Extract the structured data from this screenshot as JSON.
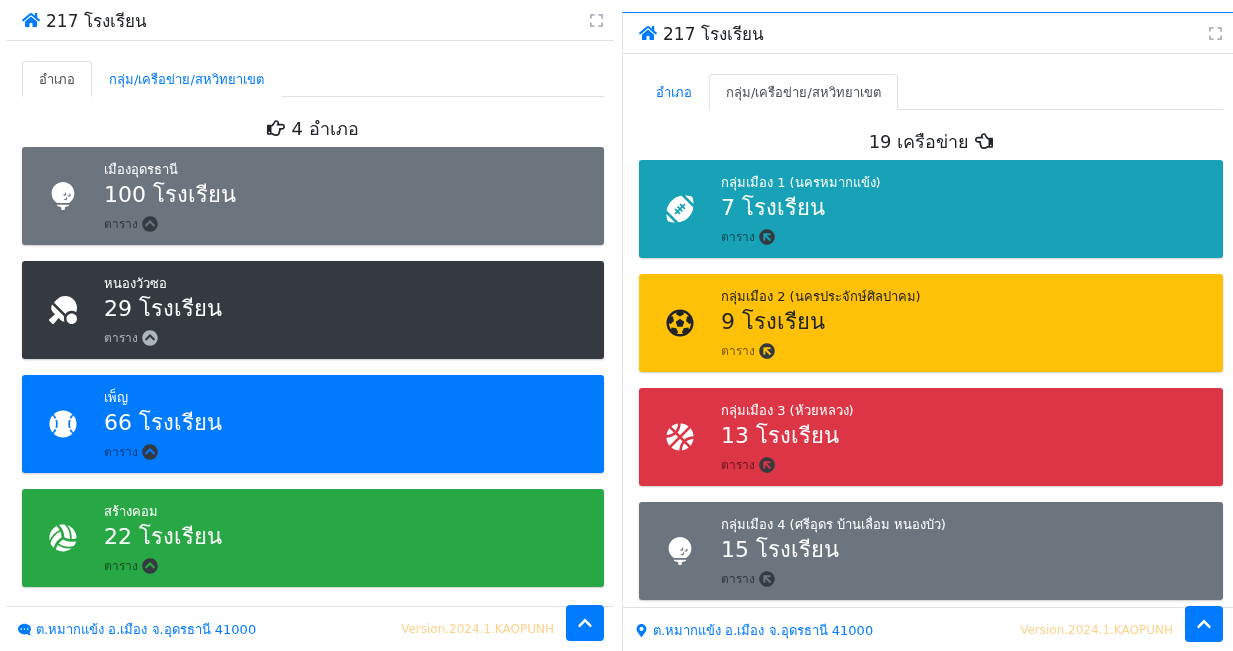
{
  "panels": [
    {
      "focused": false,
      "title": "217 โรงเรียน",
      "tabs": [
        {
          "label": "อำเภอ",
          "selected": true
        },
        {
          "label": "กลุ่ม/เครือข่าย/สหวิทยาเขต",
          "selected": false
        }
      ],
      "summary": "4 อำเภอ",
      "cards": [
        {
          "name": "เมืองอุดรธานี",
          "count": "100 โรงเรียน",
          "link": "ตาราง",
          "color": "#6c757d"
        },
        {
          "name": "หนองวัวซอ",
          "count": "29 โรงเรียน",
          "link": "ตาราง",
          "color": "#343a40"
        },
        {
          "name": "เพ็ญ",
          "count": "66 โรงเรียน",
          "link": "ตาราง",
          "color": "#007bff"
        },
        {
          "name": "สร้างคอม",
          "count": "22 โรงเรียน",
          "link": "ตาราง",
          "color": "#28a745"
        }
      ],
      "footer": {
        "address": "ต.หมากแข้ง อ.เมือง จ.อุดรธานี 41000",
        "version": "Version.2024.1.KAOPUNH"
      }
    },
    {
      "focused": true,
      "title": "217 โรงเรียน",
      "tabs": [
        {
          "label": "อำเภอ",
          "selected": false
        },
        {
          "label": "กลุ่ม/เครือข่าย/สหวิทยาเขต",
          "selected": true
        }
      ],
      "summary": "19 เครือข่าย",
      "cards": [
        {
          "name": "กลุ่มเมือง 1 (นครหมากแข้ง)",
          "count": "7 โรงเรียน",
          "link": "ตาราง",
          "color": "#17a2b8"
        },
        {
          "name": "กลุ่มเมือง 2 (นครประจักษ์ศิลปาคม)",
          "count": "9 โรงเรียน",
          "link": "ตาราง",
          "color": "#ffc107"
        },
        {
          "name": "กลุ่มเมือง 3 (ห้วยหลวง)",
          "count": "13 โรงเรียน",
          "link": "ตาราง",
          "color": "#dc3545"
        },
        {
          "name": "กลุ่มเมือง 4 (ศรีอุดร บ้านเลื่อม หนองบัว)",
          "count": "15 โรงเรียน",
          "link": "ตาราง",
          "color": "#6c757d"
        }
      ],
      "footer": {
        "address": "ต.หมากแข้ง อ.เมือง จ.อุดรธานี 41000",
        "version": "Version.2024.1.KAOPUNH"
      }
    }
  ]
}
